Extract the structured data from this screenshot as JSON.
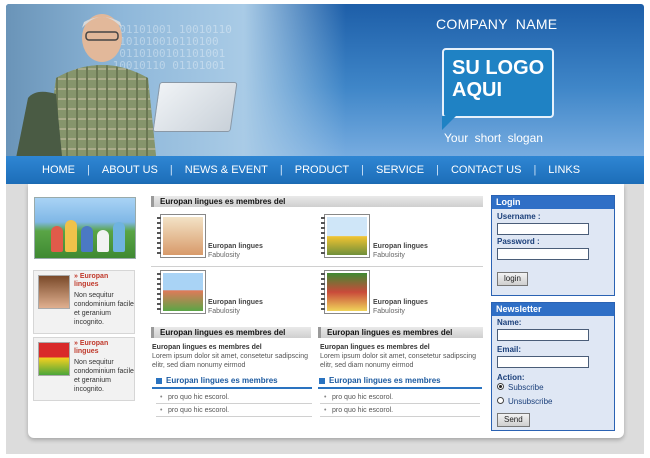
{
  "header": {
    "company_name": "COMPANY  NAME",
    "logo_text_line1": "SU LOGO",
    "logo_text_line2": "AQUI",
    "slogan": "Your  short  slogan",
    "colors": {
      "header_blue": "#1d5ea8",
      "nav_blue": "#2f86d3",
      "logo_blue": "#1f82c4"
    }
  },
  "nav": {
    "items": [
      {
        "label": "HOME"
      },
      {
        "label": "ABOUT US"
      },
      {
        "label": "NEWS & EVENT"
      },
      {
        "label": "PRODUCT"
      },
      {
        "label": "SERVICE"
      },
      {
        "label": "CONTACT US"
      },
      {
        "label": "LINKS"
      }
    ],
    "separator": "|"
  },
  "left": {
    "items": [
      {
        "title": "» Europan lingues",
        "text": "Non sequitur condominium facile et geranium incognito."
      },
      {
        "title": "» Europan lingues",
        "text": "Non sequitur condominium facile et geranium incognito."
      }
    ]
  },
  "middle": {
    "top_bar": "Europan lingues es membres del",
    "gallery": [
      {
        "title": "Europan lingues",
        "sub": "Fabulosity"
      },
      {
        "title": "Europan lingues",
        "sub": "Fabulosity"
      },
      {
        "title": "Europan lingues",
        "sub": "Fabulosity"
      },
      {
        "title": "Europan lingues",
        "sub": "Fabulosity"
      }
    ],
    "sections": [
      {
        "bar": "Europan lingues es membres del",
        "title": "Europan lingues es membres del",
        "text": "Lorem ipsum dolor sit amet, consetetur sadipscing elitr, sed diam nonumy eirmod"
      },
      {
        "bar": "Europan lingues es membres del",
        "title": "Europan lingues es membres del",
        "text": "Lorem ipsum dolor sit amet, consetetur sadipscing elitr, sed diam nonumy eirmod"
      }
    ],
    "lists": [
      {
        "head": "Europan lingues es membres",
        "items": [
          "pro quo hic escorol.",
          "pro quo hic escorol."
        ]
      },
      {
        "head": "Europan lingues es membres",
        "items": [
          "pro quo hic escorol.",
          "pro quo hic escorol."
        ]
      }
    ]
  },
  "login": {
    "title": "Login",
    "username_label": "Username :",
    "username_value": "",
    "password_label": "Password :",
    "password_value": "",
    "button": "login"
  },
  "newsletter": {
    "title": "Newsletter",
    "name_label": "Name:",
    "name_value": "",
    "email_label": "Email:",
    "email_value": "",
    "action_label": "Action:",
    "options": [
      "Subscribe",
      "Unsubscribe"
    ],
    "selected": "Subscribe",
    "button": "Send"
  },
  "icons": [
    "logo-speech-bubble-icon",
    "bullet-square-icon",
    "spiral-binding-icon",
    "radio-button-icon"
  ]
}
